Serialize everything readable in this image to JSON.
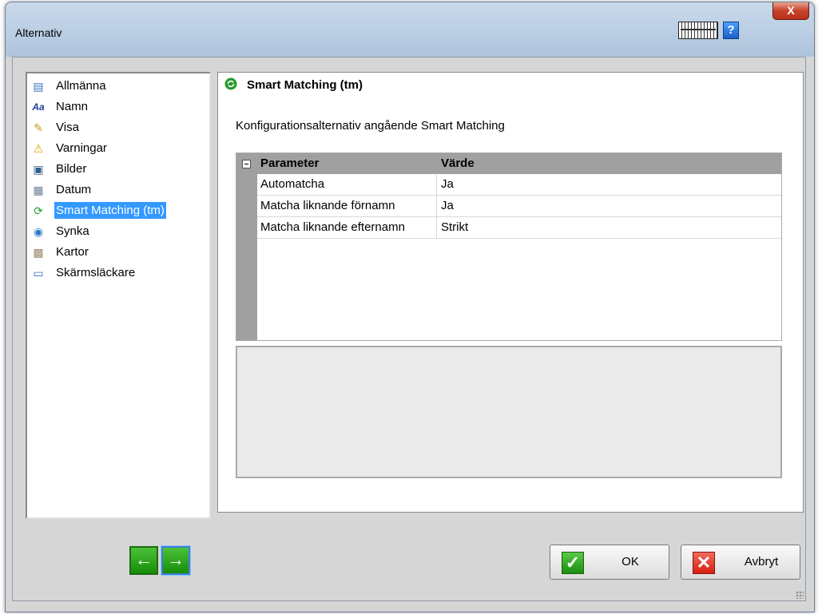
{
  "window": {
    "title": "Alternativ",
    "help_label": "?",
    "close_label": "X"
  },
  "sidebar": {
    "items": [
      {
        "label": "Allmänna",
        "icon": "document-icon",
        "glyph": "▤",
        "color": "#3a6fc4"
      },
      {
        "label": "Namn",
        "icon": "font-icon",
        "glyph": "Aa",
        "color": "#1c3fa0"
      },
      {
        "label": "Visa",
        "icon": "brush-icon",
        "glyph": "✎",
        "color": "#c99a1a"
      },
      {
        "label": "Varningar",
        "icon": "warning-icon",
        "glyph": "⚠",
        "color": "#e0a000"
      },
      {
        "label": "Bilder",
        "icon": "picture-icon",
        "glyph": "▣",
        "color": "#2f5f8a"
      },
      {
        "label": "Datum",
        "icon": "calendar-icon",
        "glyph": "▦",
        "color": "#6a7f96"
      },
      {
        "label": "Smart Matching (tm)",
        "icon": "smart-matching-icon",
        "glyph": "⟳",
        "color": "#2a9a2a",
        "selected": true
      },
      {
        "label": "Synka",
        "icon": "sync-icon",
        "glyph": "◉",
        "color": "#2a78c8"
      },
      {
        "label": "Kartor",
        "icon": "map-icon",
        "glyph": "▩",
        "color": "#9a8a6a"
      },
      {
        "label": "Skärmsläckare",
        "icon": "monitor-icon",
        "glyph": "▭",
        "color": "#3070c0"
      }
    ]
  },
  "panel": {
    "title": "Smart Matching (tm)",
    "subtitle": "Konfigurationsalternativ angående Smart Matching",
    "grid": {
      "headers": [
        "Parameter",
        "Värde"
      ],
      "rows": [
        [
          "Automatcha",
          "Ja"
        ],
        [
          "Matcha liknande förnamn",
          "Ja"
        ],
        [
          "Matcha liknande efternamn",
          "Strikt"
        ]
      ]
    }
  },
  "buttons": {
    "back": "←",
    "forward": "→",
    "ok": "OK",
    "ok_glyph": "✓",
    "cancel": "Avbryt",
    "cancel_glyph": "✕"
  },
  "colors": {
    "selection": "#3399ff",
    "accent_green": "#2a8f1c",
    "accent_red": "#d61f12"
  }
}
